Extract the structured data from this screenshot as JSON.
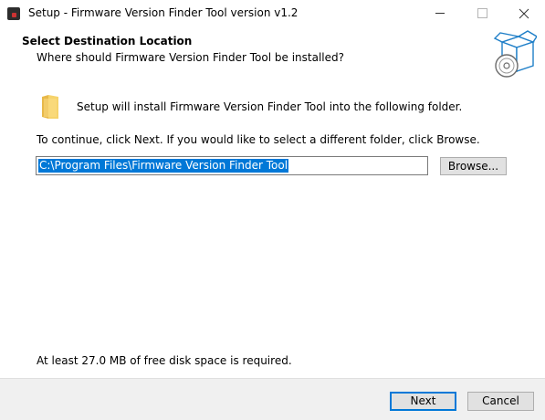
{
  "window": {
    "title": "Setup - Firmware Version Finder Tool version v1.2"
  },
  "header": {
    "title": "Select Destination Location",
    "subtitle": "Where should Firmware Version Finder Tool be installed?"
  },
  "body": {
    "intro": "Setup will install Firmware Version Finder Tool into the following folder.",
    "instructions": "To continue, click Next. If you would like to select a different folder, click Browse.",
    "path_value": "C:\\Program Files\\Firmware Version Finder Tool",
    "browse_label": "Browse...",
    "disk_space": "At least 27.0 MB of free disk space is required."
  },
  "footer": {
    "next_label": "Next",
    "cancel_label": "Cancel"
  },
  "colors": {
    "selection": "#0078d7",
    "button_face": "#e1e1e1",
    "footer_bg": "#f0f0f0"
  },
  "icons": {
    "app": "setup-app-icon",
    "folder": "folder-icon",
    "wizard": "box-with-disc-icon"
  }
}
